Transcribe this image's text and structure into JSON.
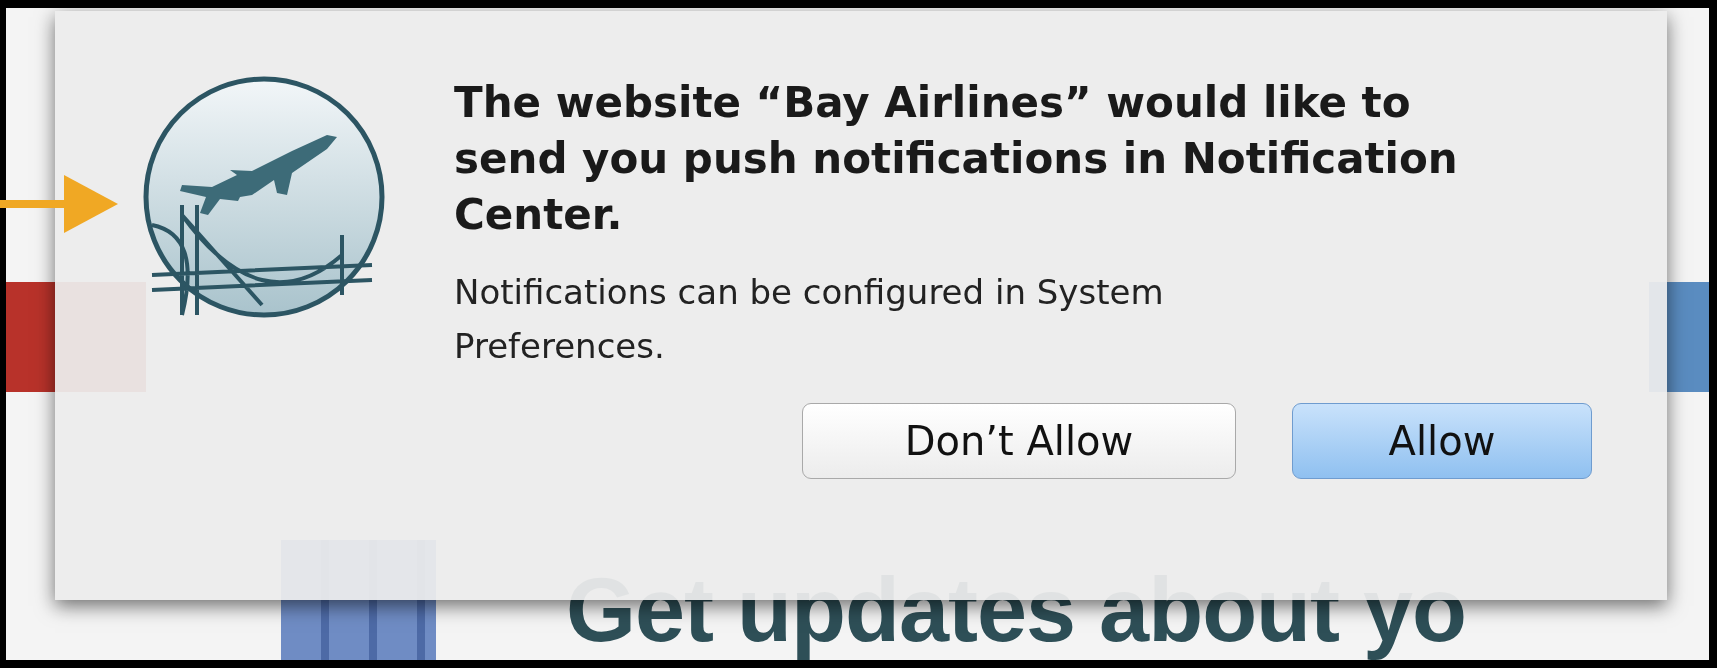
{
  "page": {
    "heading": "Get updates about yo"
  },
  "dialog": {
    "title": "The website “Bay Airlines” would like to send you push notifications in Notification Center.",
    "message": "Notifications can be configured in System Preferences.",
    "buttons": [
      {
        "label": "Don’t Allow",
        "kind": "normal"
      },
      {
        "label": "Allow",
        "kind": "default"
      }
    ]
  }
}
